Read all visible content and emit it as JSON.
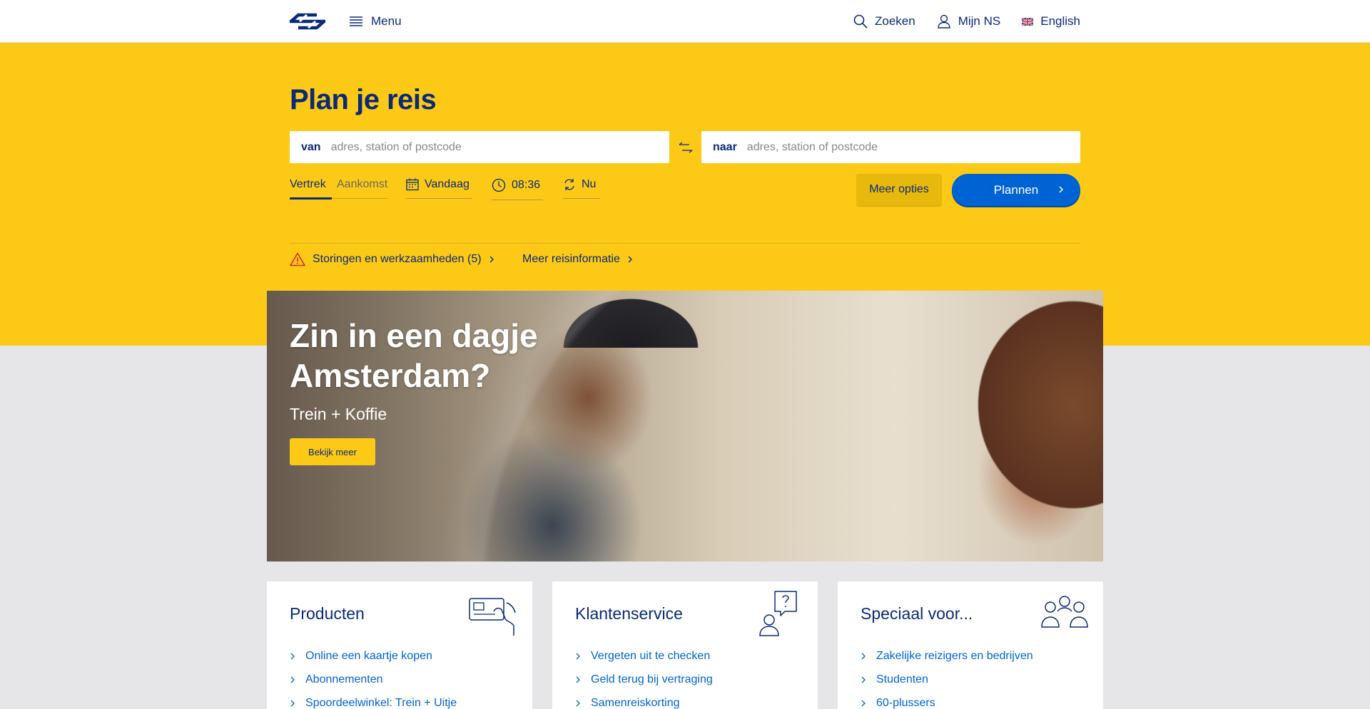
{
  "header": {
    "menu_label": "Menu",
    "nav": [
      {
        "label": "Zoeken",
        "icon": "search-icon"
      },
      {
        "label": "Mijn NS",
        "icon": "user-icon"
      },
      {
        "label": "English",
        "icon": "uk-flag-icon"
      }
    ]
  },
  "planner": {
    "title": "Plan je reis",
    "from_label": "van",
    "from_placeholder": "adres, station of postcode",
    "to_label": "naar",
    "to_placeholder": "adres, station of postcode",
    "tab_departure": "Vertrek",
    "tab_arrival": "Aankomst",
    "date": "Vandaag",
    "time": "08:36",
    "now": "Nu",
    "more_options": "Meer opties",
    "plan_button": "Plannen",
    "disruptions": "Storingen en werkzaamheden (5)",
    "more_info": "Meer reisinformatie"
  },
  "hero": {
    "title": "Zin in een dagje Amsterdam?",
    "subtitle": "Trein + Koffie",
    "button": "Bekijk meer"
  },
  "cards": [
    {
      "title": "Producten",
      "icon": "ticket-hand-icon",
      "links": [
        "Online een kaartje kopen",
        "Abonnementen",
        "Spoordeelwinkel: Trein + Uitje"
      ]
    },
    {
      "title": "Klantenservice",
      "icon": "question-person-icon",
      "links": [
        "Vergeten uit te checken",
        "Geld terug bij vertraging",
        "Samenreiskorting"
      ]
    },
    {
      "title": "Speciaal voor...",
      "icon": "group-icon",
      "links": [
        "Zakelijke reizigers en bedrijven",
        "Studenten",
        "60-plussers"
      ]
    }
  ],
  "colors": {
    "brand_yellow": "#fcc917",
    "brand_blue": "#0a2a78",
    "action_blue": "#0063d3"
  }
}
